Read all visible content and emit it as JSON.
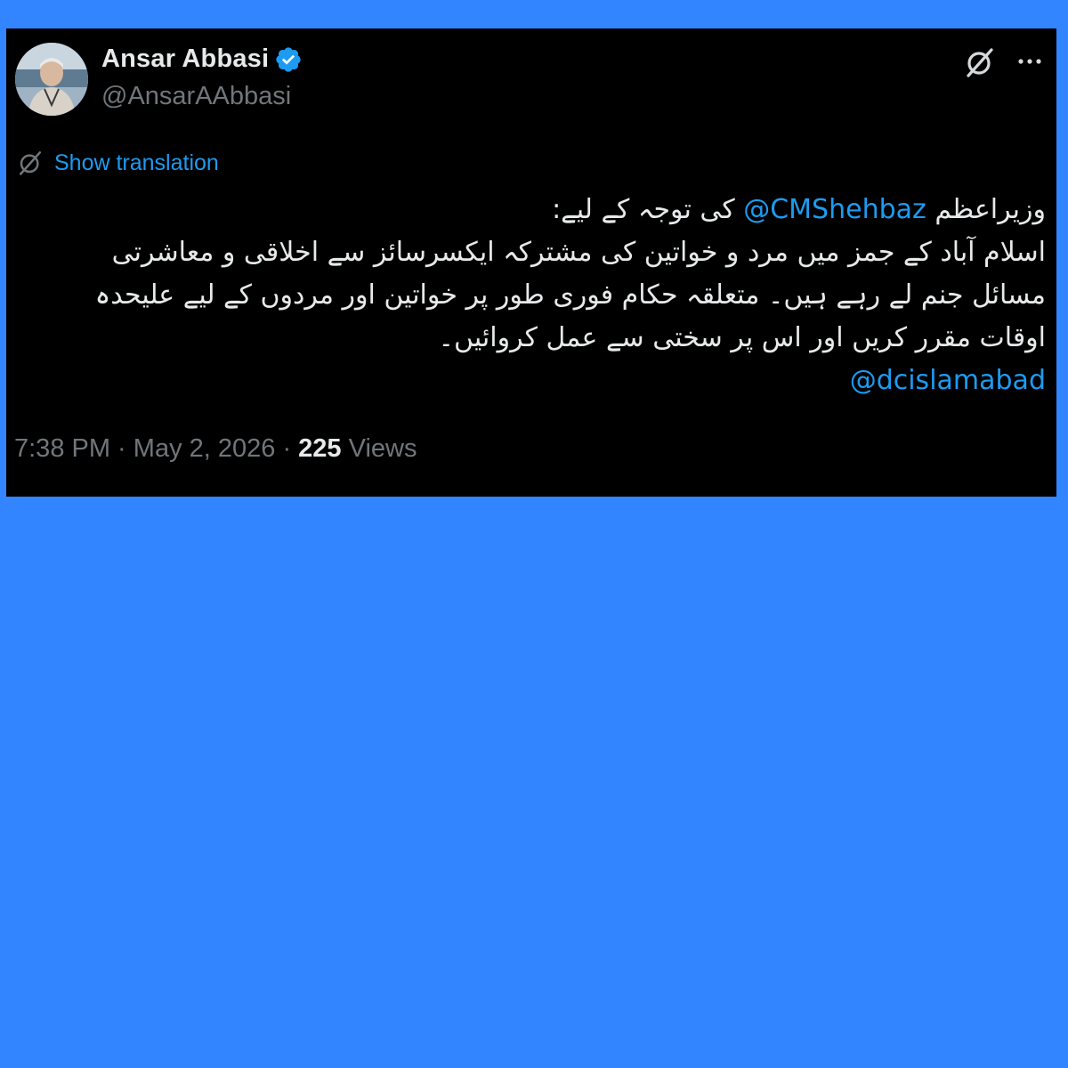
{
  "author": {
    "display_name": "Ansar Abbasi",
    "handle": "@AnsarAAbbasi",
    "verified": true
  },
  "icons": {
    "avatar": "profile-photo",
    "verified": "verified-badge-icon",
    "grok": "grok-icon",
    "more": "more-options-icon",
    "translate": "translate-icon"
  },
  "translation": {
    "label": "Show translation"
  },
  "tweet": {
    "line1_prefix": "وزیراعظم",
    "mention1": "@CMShehbaz",
    "line1_suffix": "کی توجہ کے لیے:",
    "line2": "اسلام آباد کے جمز میں مرد و خواتین کی مشترکہ ایکسرسائز سے اخلاقی و معاشرتی مسائل جنم لے رہے ہیں۔ متعلقہ حکام فوری طور پر خواتین اور مردوں کے لیے علیحدہ اوقات مقرر کریں اور اس پر سختی سے عمل کروائیں۔",
    "mention2": "@dcislamabad"
  },
  "meta": {
    "time": "7:38 PM",
    "separator": " · ",
    "date": "May 2, 2026",
    "views_count": "225",
    "views_label": " Views"
  },
  "colors": {
    "page_background": "#3385ff",
    "card_background": "#000000",
    "accent": "#1d9bf0",
    "text_primary": "#e7e9ea",
    "text_secondary": "#71767b"
  }
}
